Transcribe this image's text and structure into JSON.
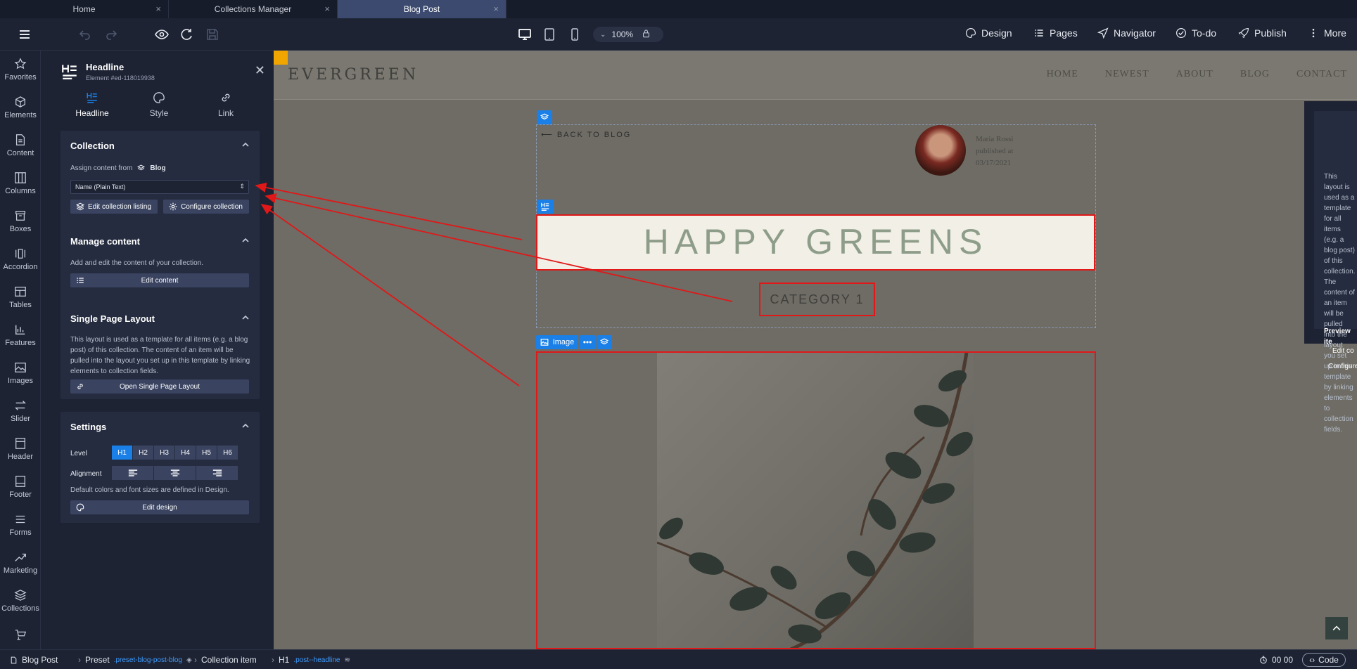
{
  "browser_tabs": [
    {
      "label": "Home"
    },
    {
      "label": "Collections Manager"
    },
    {
      "label": "Blog Post"
    }
  ],
  "toolbar": {
    "zoom": "100%",
    "design": "Design",
    "pages": "Pages",
    "navigator": "Navigator",
    "todo": "To-do",
    "publish": "Publish",
    "more": "More"
  },
  "sidebar": {
    "items": [
      {
        "label": "Favorites",
        "icon": "star-icon"
      },
      {
        "label": "Elements",
        "icon": "cube-icon"
      },
      {
        "label": "Content",
        "icon": "document-icon"
      },
      {
        "label": "Columns",
        "icon": "columns-icon"
      },
      {
        "label": "Boxes",
        "icon": "box-icon"
      },
      {
        "label": "Accordion",
        "icon": "accordion-icon"
      },
      {
        "label": "Tables",
        "icon": "table-icon"
      },
      {
        "label": "Features",
        "icon": "features-icon"
      },
      {
        "label": "Images",
        "icon": "image-icon"
      },
      {
        "label": "Slider",
        "icon": "slider-icon"
      },
      {
        "label": "Header",
        "icon": "header-icon"
      },
      {
        "label": "Footer",
        "icon": "footer-icon"
      },
      {
        "label": "Forms",
        "icon": "forms-icon"
      },
      {
        "label": "Marketing",
        "icon": "chart-line-icon"
      },
      {
        "label": "Collections",
        "icon": "layers-icon"
      }
    ]
  },
  "panel": {
    "title": "Headline",
    "subtitle": "Element #ed-118019938",
    "tabs": [
      {
        "label": "Headline"
      },
      {
        "label": "Style"
      },
      {
        "label": "Link"
      }
    ],
    "collection": {
      "title": "Collection",
      "assign_label": "Assign content from",
      "assign_source": "Blog",
      "select_value": "Name (Plain Text)",
      "edit_listing": "Edit collection listing",
      "configure": "Configure collection"
    },
    "manage": {
      "title": "Manage content",
      "desc": "Add and edit the content of your collection.",
      "edit_content": "Edit content"
    },
    "single": {
      "title": "Single Page Layout",
      "desc": "This layout is used as a template for all items (e.g. a blog post) of this collection. The content of an item will be pulled into the layout you set up in this template by linking elements to collection fields.",
      "open": "Open Single Page Layout"
    },
    "settings": {
      "title": "Settings",
      "level_label": "Level",
      "levels": [
        "H1",
        "H2",
        "H3",
        "H4",
        "H5",
        "H6"
      ],
      "alignment_label": "Alignment",
      "note": "Default colors and font sizes are defined in Design.",
      "edit_design": "Edit design"
    }
  },
  "canvas": {
    "logo": "EVERGREEN",
    "nav": [
      "HOME",
      "NEWEST",
      "ABOUT",
      "BLOG",
      "CONTACT"
    ],
    "back": "BACK TO BLOG",
    "author_name": "Maria Rossi",
    "published": "published at",
    "date": "03/17/2021",
    "headline": "HAPPY GREENS",
    "category": "CATEGORY 1",
    "image_tag": "Image",
    "side_text": "This layout is used as a template for all items (e.g. a blog post) of this collection. The content of an item will be pulled into the layout you set up in this template by linking elements to collection fields.",
    "side_preview": "Preview ite",
    "side_edit": "Edit co",
    "side_configure": "Configure"
  },
  "statusbar": {
    "page": "Blog Post",
    "preset": "Preset",
    "preset_class": ".preset-blog-post-blog",
    "item": "Collection item",
    "h1": "H1",
    "h1_class": ".post--headline",
    "time": "00 00",
    "code": "Code"
  },
  "colors": {
    "accent": "#1a80e8",
    "highlight": "#e01818",
    "headline": "#8e9d8a"
  }
}
